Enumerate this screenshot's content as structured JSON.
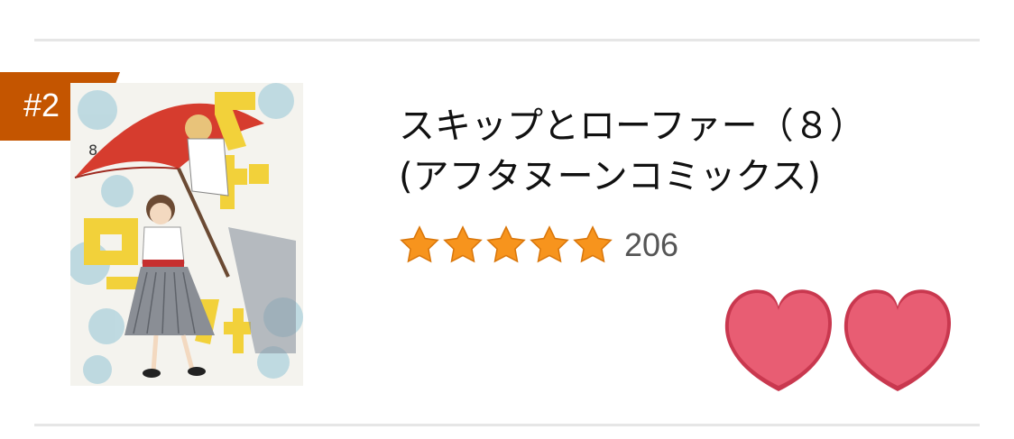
{
  "rank": {
    "label": "#2"
  },
  "product": {
    "title_line1": "スキップとローファー（８）",
    "title_line2": "(アフタヌーンコミックス)",
    "cover_image": "book-cover-skip-to-loafer-vol8-icon"
  },
  "rating": {
    "stars": 5,
    "max_stars": 5,
    "review_count": "206",
    "star_color": "#f7941d"
  },
  "decorations": [
    "heart-icon",
    "heart-icon"
  ],
  "colors": {
    "badge": "#c45500",
    "heart": "#e85d73",
    "divider": "#e6e6e6"
  }
}
